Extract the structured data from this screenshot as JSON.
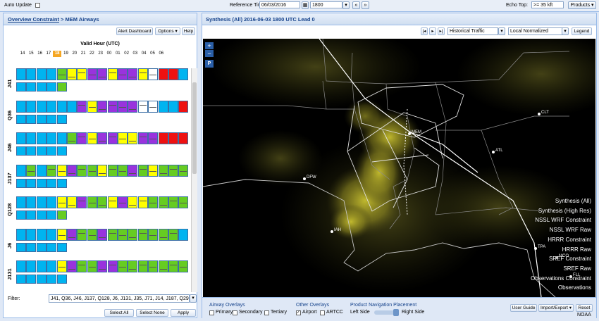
{
  "topbar": {
    "auto_update": "Auto Update",
    "reference_time_label": "Reference Time:",
    "date": "06/03/2016",
    "time": "1800",
    "echo_top_label": "Echo Top:",
    "echo_top_value": ">= 35 kft",
    "products": "Products"
  },
  "left": {
    "breadcrumb_link": "Overview Constraint",
    "breadcrumb_rest": " > MEM Airways",
    "alert_dashboard": "Alert Dashboard",
    "options": "Options",
    "help": "Help",
    "valid_hour_title": "Valid Hour (UTC)",
    "hours": [
      "14",
      "15",
      "16",
      "17",
      "18",
      "19",
      "20",
      "21",
      "22",
      "23",
      "00",
      "01",
      "02",
      "03",
      "04",
      "05",
      "06"
    ],
    "selected_hour": "18",
    "rows": [
      "J41",
      "Q36",
      "J46",
      "J137",
      "Q128",
      "J6",
      "J131"
    ],
    "filter_label": "Filter:",
    "filter_value": "J41, Q36, J46, J137, Q128, J6, J131, J35, J71, J14, J187, Q29",
    "select_all": "Select All",
    "select_none": "Select None",
    "apply": "Apply"
  },
  "right": {
    "title": "Synthesis (All) 2016-06-03 1800 UTC Lead 0",
    "historical": "Historical Traffic",
    "normalization": "Local Normalized",
    "legend_btn": "Legend",
    "zoom_in": "+",
    "zoom_out": "−",
    "p_btn": "P",
    "cities": [
      "CLT",
      "MEM",
      "ATL",
      "DFW",
      "IAH",
      "TPA",
      "MCO",
      "FLL"
    ],
    "layers": [
      "Synthesis (All)",
      "Synthesis (High Res)",
      "NSSL WRF Constraint",
      "NSSL WRF Raw",
      "HRRR Constraint",
      "HRRR Raw",
      "SREF Constraint",
      "SREF Raw",
      "Observations Constraint",
      "Observations"
    ],
    "airway_overlays": "Airway Overlays",
    "primary": "Primary",
    "secondary": "Secondary",
    "tertiary": "Tertiary",
    "other_overlays": "Other Overlays",
    "airport": "Airport",
    "artcc": "ARTCC",
    "nav_placement": "Product Navigation Placement",
    "left_side": "Left Side",
    "right_side": "Right Side",
    "user_guide": "User Guide",
    "import_export": "Import/Export",
    "reset": "Reset",
    "noaa": "NOAA"
  },
  "colors": {
    "blue": "#00b4f0",
    "green": "#66cc22",
    "yellow": "#ffff00",
    "purple": "#9933dd",
    "red": "#ee1111",
    "white": "#ffffff",
    "header_text": "#15428b"
  }
}
